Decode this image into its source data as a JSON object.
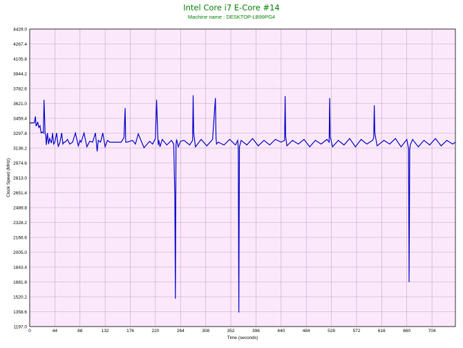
{
  "chart_data": {
    "type": "line",
    "title": "Intel Core i7 E-Core #14",
    "subtitle": "Machine name : DESKTOP-LB99PG4",
    "xlabel": "Time (seconds)",
    "ylabel": "Clock Speed (MHz)",
    "xlim": [
      0,
      745
    ],
    "ylim": [
      1197.0,
      4429.0
    ],
    "x_ticks": [
      0,
      44,
      88,
      132,
      176,
      220,
      264,
      308,
      352,
      396,
      440,
      484,
      528,
      572,
      616,
      660,
      704
    ],
    "y_ticks": [
      "1197.0",
      "1358.6",
      "1520.2",
      "1681.8",
      "1843.4",
      "2005.0",
      "2166.6",
      "2328.2",
      "2489.8",
      "2651.4",
      "2813.0",
      "2974.6",
      "3136.2",
      "3297.8",
      "3459.4",
      "3621.0",
      "3782.6",
      "3944.2",
      "4105.8",
      "4267.4",
      "4429.0"
    ],
    "grid": true,
    "colors": {
      "title": "#008000",
      "line": "#0000c8",
      "plot_bg": "#fbe9fb",
      "grid": "#c8a0c8"
    },
    "series": [
      {
        "values_note": "",
        "x": [
          0,
          5,
          8,
          10,
          11,
          12,
          14,
          16,
          18,
          20,
          22,
          24,
          25,
          27,
          28,
          29,
          31,
          33,
          35,
          38,
          40,
          42,
          44,
          47,
          50,
          53,
          56,
          58,
          60,
          62,
          66,
          70,
          75,
          80,
          85,
          88,
          90,
          95,
          100,
          105,
          110,
          115,
          118,
          120,
          124,
          128,
          132,
          136,
          140,
          150,
          160,
          165,
          167,
          168,
          170,
          180,
          185,
          190,
          200,
          210,
          215,
          220,
          222,
          224,
          225,
          226,
          228,
          232,
          240,
          248,
          252,
          254,
          255,
          256,
          257,
          260,
          264,
          270,
          280,
          285,
          286,
          287,
          290,
          300,
          310,
          320,
          325,
          326,
          327,
          330,
          340,
          350,
          360,
          364,
          365,
          366,
          367,
          370,
          380,
          390,
          400,
          410,
          420,
          430,
          440,
          446,
          447,
          448,
          450,
          460,
          470,
          480,
          490,
          500,
          510,
          520,
          524,
          525,
          526,
          530,
          540,
          550,
          560,
          570,
          580,
          590,
          600,
          602,
          603,
          604,
          608,
          620,
          630,
          640,
          650,
          660,
          663,
          664,
          665,
          666,
          670,
          680,
          690,
          700,
          710,
          720,
          730,
          740,
          745
        ],
        "y": [
          3410,
          3410,
          3410,
          3480,
          3380,
          3380,
          3420,
          3360,
          3380,
          3300,
          3310,
          3300,
          3660,
          3290,
          3280,
          3170,
          3300,
          3180,
          3240,
          3190,
          3300,
          3180,
          3200,
          3300,
          3150,
          3200,
          3300,
          3180,
          3200,
          3200,
          3230,
          3180,
          3200,
          3300,
          3160,
          3220,
          3200,
          3300,
          3150,
          3210,
          3200,
          3300,
          3100,
          3220,
          3200,
          3300,
          3150,
          3220,
          3200,
          3200,
          3200,
          3250,
          3570,
          3200,
          3200,
          3220,
          3180,
          3290,
          3140,
          3210,
          3180,
          3240,
          3660,
          3300,
          3170,
          3220,
          3150,
          3230,
          3170,
          3220,
          3180,
          2600,
          1500,
          3170,
          3230,
          3150,
          3210,
          3220,
          3170,
          3220,
          3710,
          3300,
          3150,
          3230,
          3160,
          3230,
          3680,
          3250,
          3180,
          3200,
          3170,
          3230,
          3170,
          3220,
          3130,
          1350,
          3150,
          3220,
          3170,
          3240,
          3160,
          3220,
          3170,
          3230,
          3200,
          3220,
          3700,
          3260,
          3160,
          3220,
          3180,
          3230,
          3150,
          3220,
          3180,
          3230,
          3200,
          3680,
          3260,
          3150,
          3220,
          3170,
          3240,
          3150,
          3230,
          3180,
          3220,
          3250,
          3600,
          3300,
          3160,
          3220,
          3180,
          3240,
          3150,
          3230,
          3130,
          1680,
          3120,
          3170,
          3230,
          3150,
          3220,
          3170,
          3240,
          3160,
          3220,
          3180,
          3200
        ]
      }
    ]
  }
}
